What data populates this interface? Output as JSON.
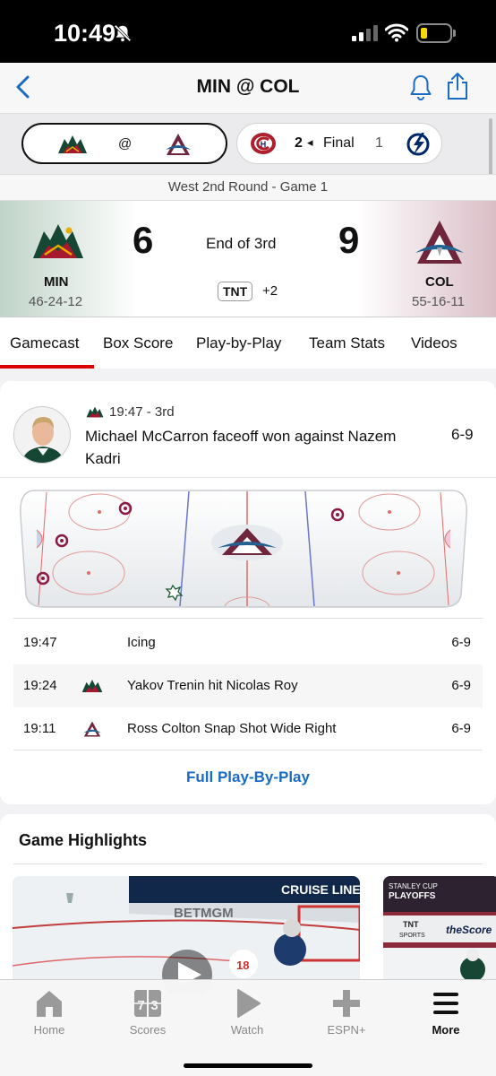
{
  "status_bar": {
    "time": "10:49"
  },
  "nav": {
    "title": "MIN @ COL"
  },
  "score_strip": {
    "current": {
      "separator": "@"
    },
    "other_game": {
      "score_left": "2",
      "indicator": "◂",
      "status": "Final",
      "score_right": "1"
    }
  },
  "game": {
    "round": "West 2nd Round - Game 1",
    "home": {
      "abbr": "MIN",
      "record": "46-24-12",
      "score": "6"
    },
    "away": {
      "abbr": "COL",
      "record": "55-16-11",
      "score": "9"
    },
    "period": "End of 3rd",
    "network": "TNT",
    "network_more": "+2"
  },
  "tabs": [
    "Gamecast",
    "Box Score",
    "Play-by-Play",
    "Team Stats",
    "Videos"
  ],
  "play": {
    "time": "19:47 - 3rd",
    "description": "Michael McCarron faceoff won against Nazem Kadri",
    "score": "6-9"
  },
  "pbp_rows": [
    {
      "time": "19:47",
      "desc": "Icing",
      "score": "6-9",
      "team_icon": ""
    },
    {
      "time": "19:24",
      "desc": "Yakov Trenin hit Nicolas Roy",
      "score": "6-9",
      "team_icon": "wild-logo"
    },
    {
      "time": "19:11",
      "desc": "Ross Colton Snap Shot Wide Right",
      "score": "6-9",
      "team_icon": "avalanche-logo"
    }
  ],
  "full_pbp_label": "Full Play-By-Play",
  "highlights": {
    "title": "Game Highlights",
    "thumb1_overlay_text": "CRUISE LINE",
    "thumb1_board_text": "BETMGM",
    "thumb2_text": {
      "cup": "STANLEY CUP",
      "playoffs": "PLAYOFFS",
      "network": "TNT",
      "network_sub": "SPORTS",
      "brand": "theScore"
    }
  },
  "tab_bar": [
    {
      "label": "Home",
      "icon": "home-icon"
    },
    {
      "label": "Scores",
      "icon": "scores-icon"
    },
    {
      "label": "Watch",
      "icon": "play-icon"
    },
    {
      "label": "ESPN+",
      "icon": "plus-icon"
    },
    {
      "label": "More",
      "icon": "menu-icon"
    }
  ],
  "colors": {
    "accent": "#1a6bc4",
    "tab_underline": "#dd0000",
    "wild_green": "#154734",
    "wild_red": "#a6192e",
    "avs_burgundy": "#6f263d",
    "avs_blue": "#236192"
  }
}
